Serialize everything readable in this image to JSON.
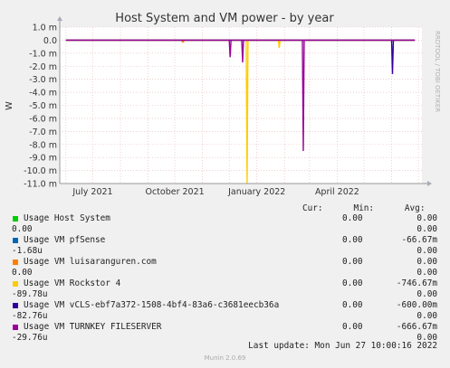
{
  "chart_data": {
    "type": "line",
    "title": "Host System and VM power - by year",
    "ylabel": "W",
    "ylim": [
      -11.0,
      1.0
    ],
    "yticks": [
      "1.0 m",
      "0.0",
      "-1.0 m",
      "-2.0 m",
      "-3.0 m",
      "-4.0 m",
      "-5.0 m",
      "-6.0 m",
      "-7.0 m",
      "-8.0 m",
      "-9.0 m",
      "-10.0 m",
      "-11.0 m"
    ],
    "xlim": [
      "2021-05-25",
      "2022-07-05"
    ],
    "xticks": [
      {
        "label": "July 2021",
        "date": "2021-07-01"
      },
      {
        "label": "October 2021",
        "date": "2021-10-01"
      },
      {
        "label": "January 2022",
        "date": "2022-01-01"
      },
      {
        "label": "April 2022",
        "date": "2022-04-01"
      }
    ],
    "grid": true,
    "side_label": "RRDTOOL / TOBI OETIKER",
    "series": [
      {
        "name": "Usage Host System",
        "color": "#00cc00",
        "points": [
          [
            "2021-06-01",
            0
          ],
          [
            "2022-06-27",
            0
          ]
        ]
      },
      {
        "name": "Usage VM pfSense",
        "color": "#0066b3",
        "points": [
          [
            "2021-06-01",
            0
          ],
          [
            "2022-06-27",
            0
          ]
        ]
      },
      {
        "name": "Usage VM luisaranguren.com",
        "color": "#ff8000",
        "points": [
          [
            "2021-06-01",
            0
          ],
          [
            "2021-10-08",
            0
          ],
          [
            "2021-10-10",
            -0.15
          ],
          [
            "2021-10-12",
            0
          ],
          [
            "2022-06-27",
            0
          ]
        ]
      },
      {
        "name": "Usage VM Rockstor 4",
        "color": "#ffcc00",
        "points": [
          [
            "2021-06-01",
            0
          ],
          [
            "2021-12-20",
            0
          ],
          [
            "2021-12-21",
            -11.0
          ],
          [
            "2021-12-22",
            0
          ],
          [
            "2022-01-25",
            0
          ],
          [
            "2022-01-26",
            -0.6
          ],
          [
            "2022-01-27",
            0
          ],
          [
            "2022-06-27",
            0
          ]
        ]
      },
      {
        "name": "Usage VM vCLS-ebf7a372-1508-4bf4-83a6-c3681eecb36a",
        "color": "#330099",
        "points": [
          [
            "2021-06-01",
            0
          ],
          [
            "2022-06-01",
            0
          ],
          [
            "2022-06-02",
            -2.6
          ],
          [
            "2022-06-03",
            0
          ],
          [
            "2022-06-27",
            0
          ]
        ]
      },
      {
        "name": "Usage VM TURNKEY FILESERVER",
        "color": "#990099",
        "points": [
          [
            "2021-06-01",
            0
          ],
          [
            "2021-12-01",
            0
          ],
          [
            "2021-12-02",
            -1.3
          ],
          [
            "2021-12-03",
            0
          ],
          [
            "2021-12-15",
            0
          ],
          [
            "2021-12-16",
            -1.7
          ],
          [
            "2021-12-17",
            0
          ],
          [
            "2022-02-21",
            0
          ],
          [
            "2022-02-22",
            -8.5
          ],
          [
            "2022-02-23",
            0
          ],
          [
            "2022-06-27",
            0
          ]
        ]
      }
    ]
  },
  "legend": {
    "header": "Cur:      Min:      Avg:     Max:",
    "rows": [
      {
        "name": "Usage Host System",
        "color": "#00cc00",
        "cur": "0.00",
        "min": "0.00",
        "avg": "0.00",
        "max": "0.00"
      },
      {
        "name": "Usage VM pfSense",
        "color": "#0066b3",
        "cur": "0.00",
        "min": "-66.67m",
        "avg": "-1.68u",
        "max": "0.00"
      },
      {
        "name": "Usage VM luisaranguren.com",
        "color": "#ff8000",
        "cur": "0.00",
        "min": "0.00",
        "avg": "0.00",
        "max": "0.00"
      },
      {
        "name": "Usage VM Rockstor 4",
        "color": "#ffcc00",
        "cur": "0.00",
        "min": "-746.67m",
        "avg": "-89.78u",
        "max": "0.00"
      },
      {
        "name": "Usage VM vCLS-ebf7a372-1508-4bf4-83a6-c3681eecb36a",
        "color": "#330099",
        "cur": "0.00",
        "min": "-600.00m",
        "avg": "-82.76u",
        "max": "0.00"
      },
      {
        "name": "Usage VM TURNKEY FILESERVER",
        "color": "#990099",
        "cur": "0.00",
        "min": "-666.67m",
        "avg": "-29.76u",
        "max": "0.00"
      }
    ]
  },
  "footer": {
    "last_update": "Last update: Mon Jun 27 10:00:16 2022",
    "munin": "Munin 2.0.69"
  }
}
